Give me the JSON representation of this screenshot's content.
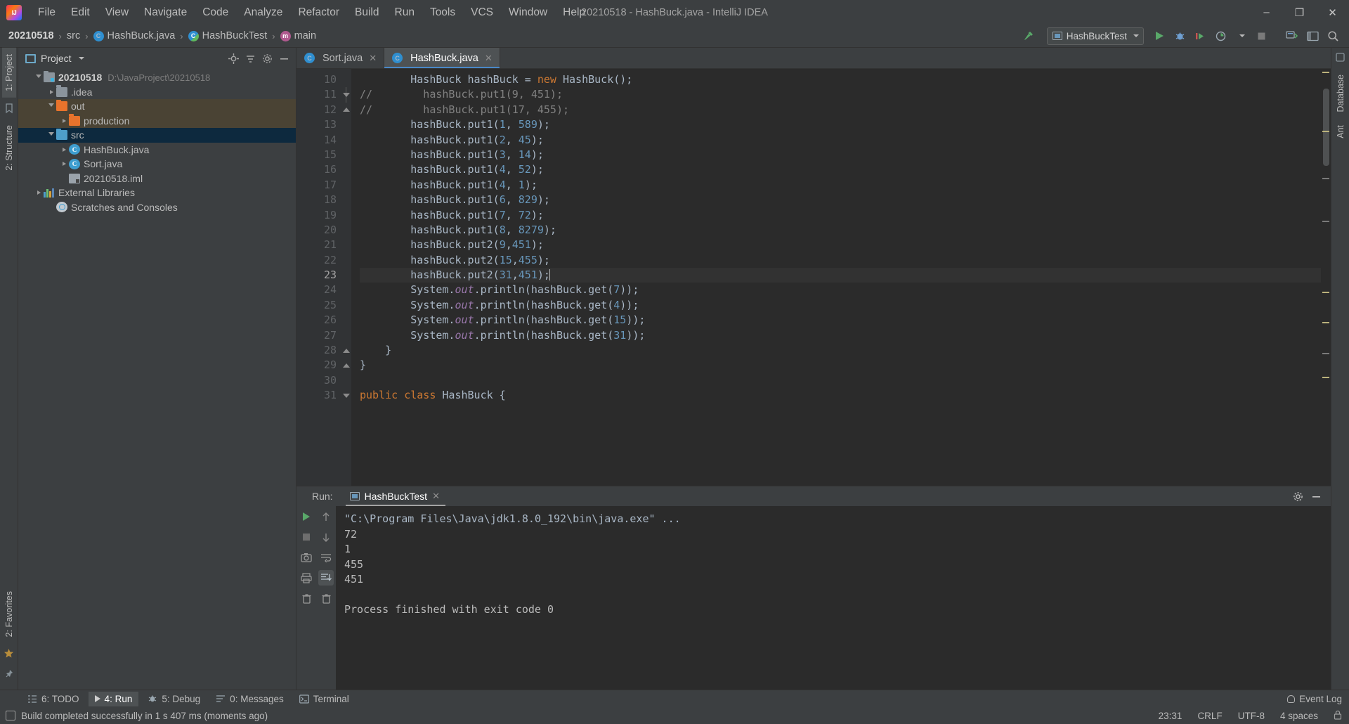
{
  "window": {
    "title": "20210518 - HashBuck.java - IntelliJ IDEA",
    "minimize": "–",
    "maximize": "❐",
    "close": "✕"
  },
  "menu": {
    "items": [
      "File",
      "Edit",
      "View",
      "Navigate",
      "Code",
      "Analyze",
      "Refactor",
      "Build",
      "Run",
      "Tools",
      "VCS",
      "Window",
      "Help"
    ]
  },
  "breadcrumb": {
    "items": [
      {
        "label": "20210518",
        "icon": "none"
      },
      {
        "label": "src",
        "icon": "none"
      },
      {
        "label": "HashBuck.java",
        "icon": "class-icon"
      },
      {
        "label": "HashBuckTest",
        "icon": "class-test-icon"
      },
      {
        "label": "main",
        "icon": "method-icon"
      }
    ],
    "separator": "›"
  },
  "toolbar": {
    "build_label": "build-hammer",
    "run_config": "HashBuckTest",
    "run": "run-button",
    "debug": "debug-button",
    "coverage": "run-with-coverage-button",
    "profile": "profiler-button",
    "stop": "stop-button",
    "updates": "update-button",
    "layout": "layout-button",
    "search": "search-everywhere"
  },
  "left_strip": {
    "project_tab": "1: Project",
    "structure_tab": "2: Structure",
    "favorites_tab": "2: Favorites"
  },
  "right_strip": {
    "database_tab": "Database",
    "ant_tab": "Ant"
  },
  "project_panel": {
    "title": "Project",
    "tree": [
      {
        "label": "20210518",
        "path": "D:\\JavaProject\\20210518",
        "icon": "module-icon",
        "indent": 0,
        "arrow": "open",
        "bold": true,
        "state": "normal"
      },
      {
        "label": ".idea",
        "path": "",
        "icon": "folder-icon",
        "indent": 1,
        "arrow": "closed",
        "bold": false,
        "state": "normal"
      },
      {
        "label": "out",
        "path": "",
        "icon": "folder-orange-icon",
        "indent": 1,
        "arrow": "open",
        "bold": false,
        "state": "highlight"
      },
      {
        "label": "production",
        "path": "",
        "icon": "folder-orange-icon",
        "indent": 2,
        "arrow": "closed",
        "bold": false,
        "state": "highlight"
      },
      {
        "label": "src",
        "path": "",
        "icon": "folder-blue-icon",
        "indent": 1,
        "arrow": "open",
        "bold": false,
        "state": "selected"
      },
      {
        "label": "HashBuck.java",
        "path": "",
        "icon": "java-class-icon",
        "indent": 2,
        "arrow": "closed",
        "bold": false,
        "state": "normal"
      },
      {
        "label": "Sort.java",
        "path": "",
        "icon": "java-class-icon",
        "indent": 2,
        "arrow": "closed",
        "bold": false,
        "state": "normal"
      },
      {
        "label": "20210518.iml",
        "path": "",
        "icon": "iml-file-icon",
        "indent": 2,
        "arrow": "none",
        "bold": false,
        "state": "normal"
      },
      {
        "label": "External Libraries",
        "path": "",
        "icon": "libraries-icon",
        "indent": 0,
        "arrow": "closed",
        "bold": false,
        "state": "normal"
      },
      {
        "label": "Scratches and Consoles",
        "path": "",
        "icon": "scratches-icon",
        "indent": 0,
        "arrow": "none",
        "bold": false,
        "state": "normal"
      }
    ]
  },
  "editor": {
    "tabs": [
      {
        "label": "Sort.java",
        "active": false
      },
      {
        "label": "HashBuck.java",
        "active": true
      }
    ],
    "close_glyph": "✕",
    "first_line_number": 10,
    "current_line": 23,
    "lines": [
      {
        "n": 10,
        "text": "        HashBuck hashBuck = new HashBuck();",
        "fold": "none"
      },
      {
        "n": 11,
        "text": "//        hashBuck.put1(9, 451);",
        "fold": "tri"
      },
      {
        "n": 12,
        "text": "//        hashBuck.put1(17, 455);",
        "fold": "up"
      },
      {
        "n": 13,
        "text": "        hashBuck.put1(1, 589);",
        "fold": "none"
      },
      {
        "n": 14,
        "text": "        hashBuck.put1(2, 45);",
        "fold": "none"
      },
      {
        "n": 15,
        "text": "        hashBuck.put1(3, 14);",
        "fold": "none"
      },
      {
        "n": 16,
        "text": "        hashBuck.put1(4, 52);",
        "fold": "none"
      },
      {
        "n": 17,
        "text": "        hashBuck.put1(4, 1);",
        "fold": "none"
      },
      {
        "n": 18,
        "text": "        hashBuck.put1(6, 829);",
        "fold": "none"
      },
      {
        "n": 19,
        "text": "        hashBuck.put1(7, 72);",
        "fold": "none"
      },
      {
        "n": 20,
        "text": "        hashBuck.put1(8, 8279);",
        "fold": "none"
      },
      {
        "n": 21,
        "text": "        hashBuck.put2(9,451);",
        "fold": "none"
      },
      {
        "n": 22,
        "text": "        hashBuck.put2(15,455);",
        "fold": "none"
      },
      {
        "n": 23,
        "text": "        hashBuck.put2(31,451);",
        "fold": "none"
      },
      {
        "n": 24,
        "text": "        System.out.println(hashBuck.get(7));",
        "fold": "none"
      },
      {
        "n": 25,
        "text": "        System.out.println(hashBuck.get(4));",
        "fold": "none"
      },
      {
        "n": 26,
        "text": "        System.out.println(hashBuck.get(15));",
        "fold": "none"
      },
      {
        "n": 27,
        "text": "        System.out.println(hashBuck.get(31));",
        "fold": "none"
      },
      {
        "n": 28,
        "text": "    }",
        "fold": "box"
      },
      {
        "n": 29,
        "text": "}",
        "fold": "box"
      },
      {
        "n": 30,
        "text": "",
        "fold": "none"
      },
      {
        "n": 31,
        "text": "public class HashBuck {",
        "fold": "box"
      }
    ]
  },
  "run_panel": {
    "label": "Run:",
    "tab": "HashBuckTest",
    "close_glyph": "✕",
    "console": [
      "\"C:\\Program Files\\Java\\jdk1.8.0_192\\bin\\java.exe\" ...",
      "72",
      "1",
      "455",
      "451",
      "",
      "Process finished with exit code 0"
    ],
    "tools": [
      "rerun-button",
      "stop-button",
      "screenshot-button",
      "print-button",
      "trash-button",
      "scroll-up-button",
      "scroll-down-button",
      "soft-wrap-button",
      "scroll-to-end-button",
      "trash-console-button"
    ],
    "settings": "settings-gear",
    "hide": "hide-panel"
  },
  "bottom_tabs": [
    {
      "num": "6",
      "label": "TODO",
      "icon": "todo-icon",
      "active": false
    },
    {
      "num": "4",
      "label": "Run",
      "icon": "run-icon",
      "active": true
    },
    {
      "num": "5",
      "label": "Debug",
      "icon": "debug-icon",
      "active": false
    },
    {
      "num": "0",
      "label": "Messages",
      "icon": "messages-icon",
      "active": false
    },
    {
      "num": "",
      "label": "Terminal",
      "icon": "terminal-icon",
      "active": false
    }
  ],
  "status": {
    "message": "Build completed successfully in 1 s 407 ms (moments ago)",
    "caret": "23:31",
    "line_sep": "CRLF",
    "encoding": "UTF-8",
    "indent": "4 spaces",
    "event_log": "Event Log"
  },
  "colors": {
    "accent_blue": "#4a88c7",
    "selection": "#0d293e",
    "highlight": "#4a4334",
    "green_run": "#59a869",
    "editor_bg": "#2b2b2b",
    "panel_bg": "#3c3f41"
  }
}
